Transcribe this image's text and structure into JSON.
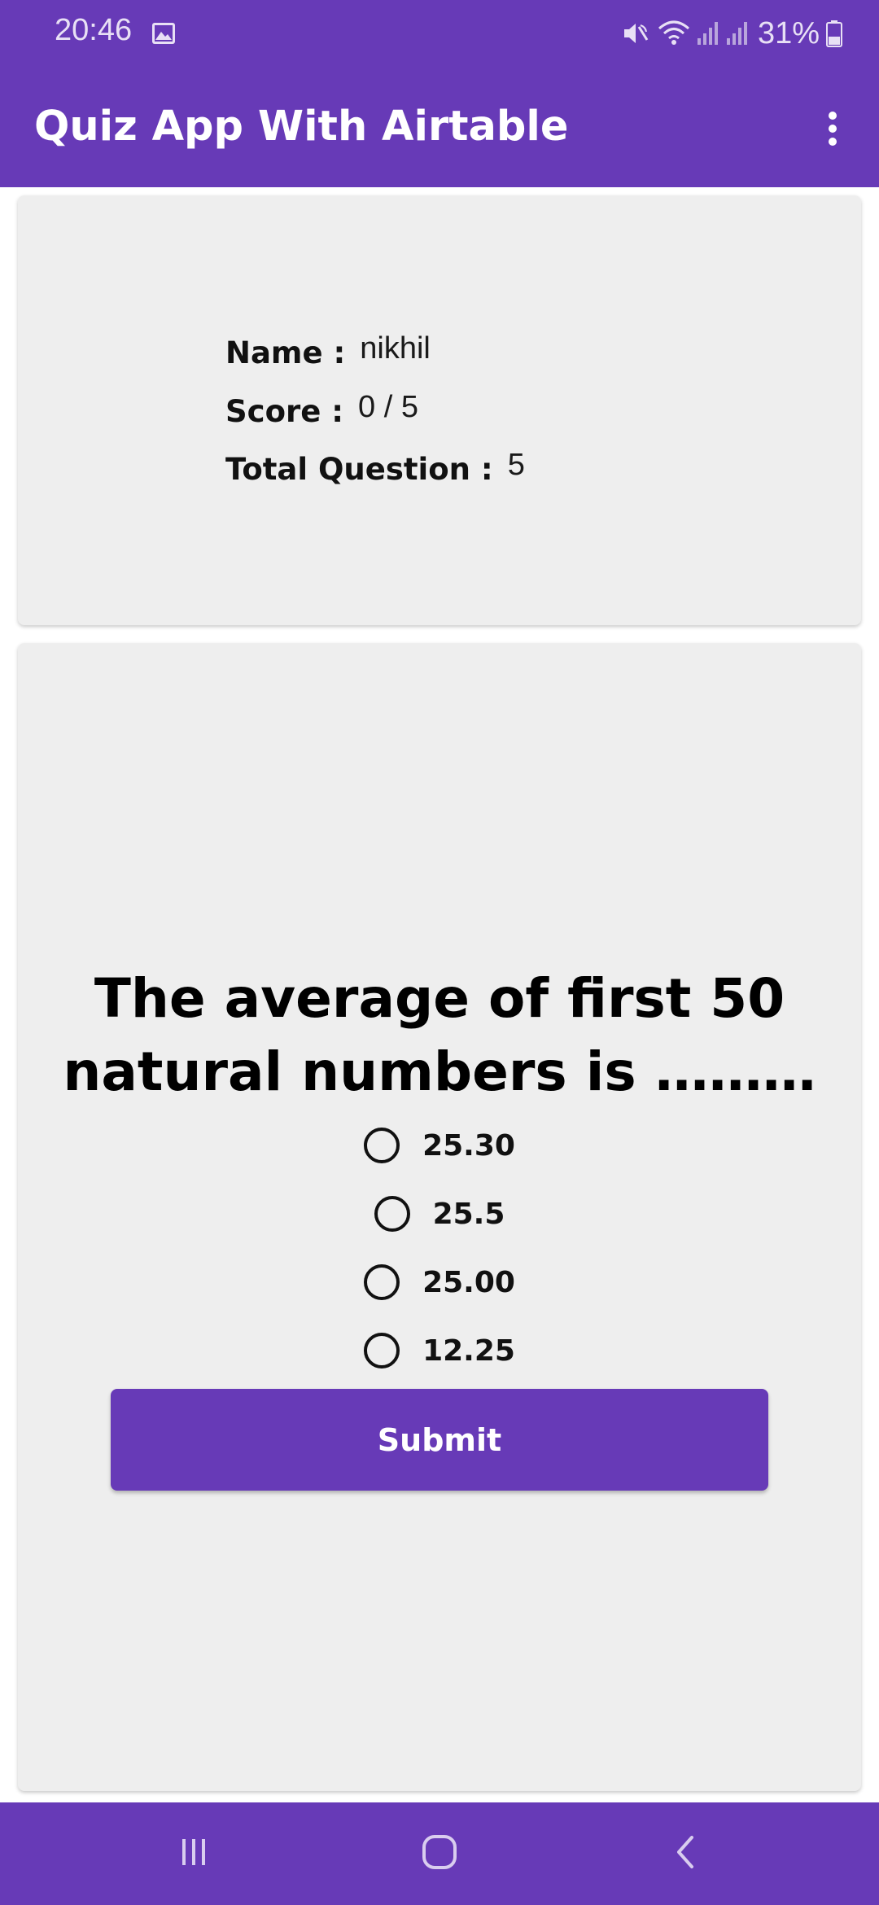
{
  "status_bar": {
    "time": "20:46",
    "battery": "31%",
    "icons": [
      "image-icon",
      "mute-icon",
      "wifi-icon",
      "signal-icon",
      "signal-icon",
      "battery-icon"
    ]
  },
  "app_bar": {
    "title": "Quiz App With Airtable",
    "menu_icon": "more-vert-icon"
  },
  "info_card": {
    "name_label": "Name :",
    "name_value": "nikhil",
    "score_label": "Score :",
    "score_value": "0 / 5",
    "total_label": "Total Question :",
    "total_value": "5"
  },
  "quiz": {
    "question_line1": "The average of first 50",
    "question_line2": "natural numbers is ………",
    "options": [
      {
        "label": "25.30",
        "selected": false
      },
      {
        "label": "25.5",
        "selected": false
      },
      {
        "label": "25.00",
        "selected": false
      },
      {
        "label": "12.25",
        "selected": false
      }
    ],
    "submit_label": "Submit"
  },
  "nav_bar": {
    "icons": [
      "recent-apps-icon",
      "home-icon",
      "back-icon"
    ]
  },
  "colors": {
    "primary": "#673ab7",
    "card_background": "#eeeeee"
  }
}
